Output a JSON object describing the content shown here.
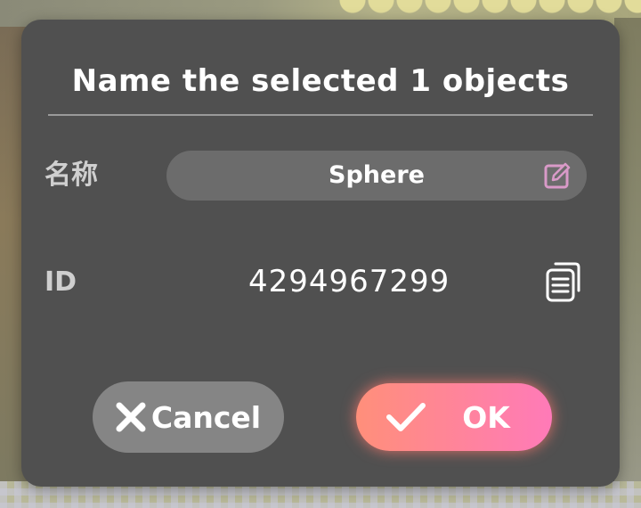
{
  "dialog": {
    "title": "Name the selected 1 objects",
    "name_label": "名称",
    "name_value": "Sphere",
    "id_label": "ID",
    "id_value": "4294967299",
    "cancel_label": "Cancel",
    "ok_label": "OK"
  },
  "icons": {
    "edit": "edit-icon",
    "copy": "copy-icon",
    "cancel": "close-icon",
    "ok": "checkmark-icon"
  },
  "colors": {
    "dialog_bg": "#505050",
    "field_bg": "#6c6c6c",
    "cancel_bg": "#858585",
    "ok_gradient_start": "#ff8f7a",
    "ok_gradient_end": "#ff7ab8",
    "edit_icon": "#d99ac8"
  }
}
